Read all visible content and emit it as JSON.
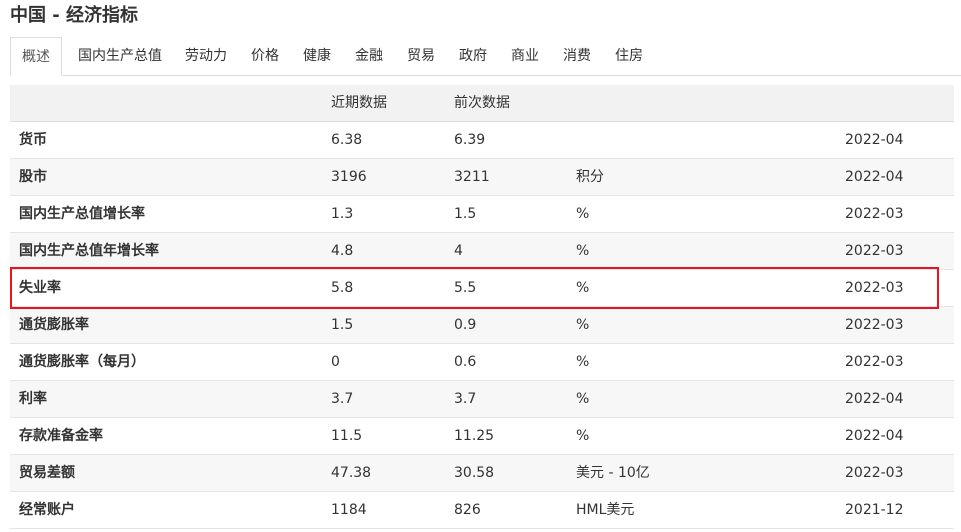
{
  "page": {
    "title": "中国 - 经济指标"
  },
  "tabs": [
    {
      "label": "概述",
      "active": true
    },
    {
      "label": "国内生产总值",
      "active": false
    },
    {
      "label": "劳动力",
      "active": false
    },
    {
      "label": "价格",
      "active": false
    },
    {
      "label": "健康",
      "active": false
    },
    {
      "label": "金融",
      "active": false
    },
    {
      "label": "贸易",
      "active": false
    },
    {
      "label": "政府",
      "active": false
    },
    {
      "label": "商业",
      "active": false
    },
    {
      "label": "消费",
      "active": false
    },
    {
      "label": "住房",
      "active": false
    }
  ],
  "table": {
    "headers": {
      "name": "",
      "last": "近期数据",
      "previous": "前次数据",
      "unit": "",
      "date": ""
    },
    "rows": [
      {
        "name": "货币",
        "last": "6.38",
        "previous": "6.39",
        "unit": "",
        "date": "2022-04"
      },
      {
        "name": "股市",
        "last": "3196",
        "previous": "3211",
        "unit": "积分",
        "date": "2022-04"
      },
      {
        "name": "国内生产总值增长率",
        "last": "1.3",
        "previous": "1.5",
        "unit": "%",
        "date": "2022-03"
      },
      {
        "name": "国内生产总值年增长率",
        "last": "4.8",
        "previous": "4",
        "unit": "%",
        "date": "2022-03"
      },
      {
        "name": "失业率",
        "last": "5.8",
        "previous": "5.5",
        "unit": "%",
        "date": "2022-03",
        "highlighted": true
      },
      {
        "name": "通货膨胀率",
        "last": "1.5",
        "previous": "0.9",
        "unit": "%",
        "date": "2022-03"
      },
      {
        "name": "通货膨胀率（每月）",
        "last": "0",
        "previous": "0.6",
        "unit": "%",
        "date": "2022-03"
      },
      {
        "name": "利率",
        "last": "3.7",
        "previous": "3.7",
        "unit": "%",
        "date": "2022-04"
      },
      {
        "name": "存款准备金率",
        "last": "11.5",
        "previous": "11.25",
        "unit": "%",
        "date": "2022-04"
      },
      {
        "name": "贸易差额",
        "last": "47.38",
        "previous": "30.58",
        "unit": "美元 - 10亿",
        "date": "2022-03"
      },
      {
        "name": "经常账户",
        "last": "1184",
        "previous": "826",
        "unit": "HML美元",
        "date": "2021-12"
      }
    ]
  },
  "colors": {
    "highlight_border": "#e8161c",
    "header_bg": "#f2f2f2",
    "row_alt_bg": "#f7f7f7"
  }
}
